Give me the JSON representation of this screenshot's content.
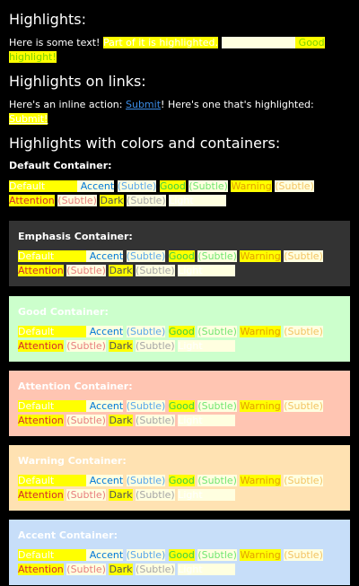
{
  "sections": {
    "highlights": {
      "heading": "Highlights:",
      "text_plain": "Here is some text! ",
      "text_hl1": "Part of it is highlighted.",
      "text_space": " ",
      "text_hl2": "Some is lighter",
      "text_hl3": " Good",
      "text_hl4": "highlight!"
    },
    "links": {
      "heading": "Highlights on links:",
      "text1": "Here's an inline action: ",
      "link1": "Submit",
      "text2": "! Here's one that's highlighted: ",
      "link2": "Submit!"
    },
    "colors": {
      "heading": "Highlights with colors and containers:"
    }
  },
  "labels": {
    "default": "Default",
    "accent": "Accent",
    "subtle": "(Subtle)",
    "good": "Good",
    "warning": "Warning",
    "attention": "Attention",
    "dark": "Dark",
    "light": "Light"
  },
  "containers": [
    {
      "title": "Default Container:"
    },
    {
      "title": "Emphasis Container:"
    },
    {
      "title": "Good Container:"
    },
    {
      "title": "Attention Container:"
    },
    {
      "title": "Warning Container:"
    },
    {
      "title": "Accent Container:"
    }
  ],
  "colors": {
    "background": "#000000",
    "highlight": "#ffff00",
    "emphasis_bg": "#333333",
    "good_bg": "#ccffcc",
    "attention_bg": "#ffc5b2",
    "warning_bg": "#ffe2b2",
    "accent_bg": "#c7def9"
  }
}
